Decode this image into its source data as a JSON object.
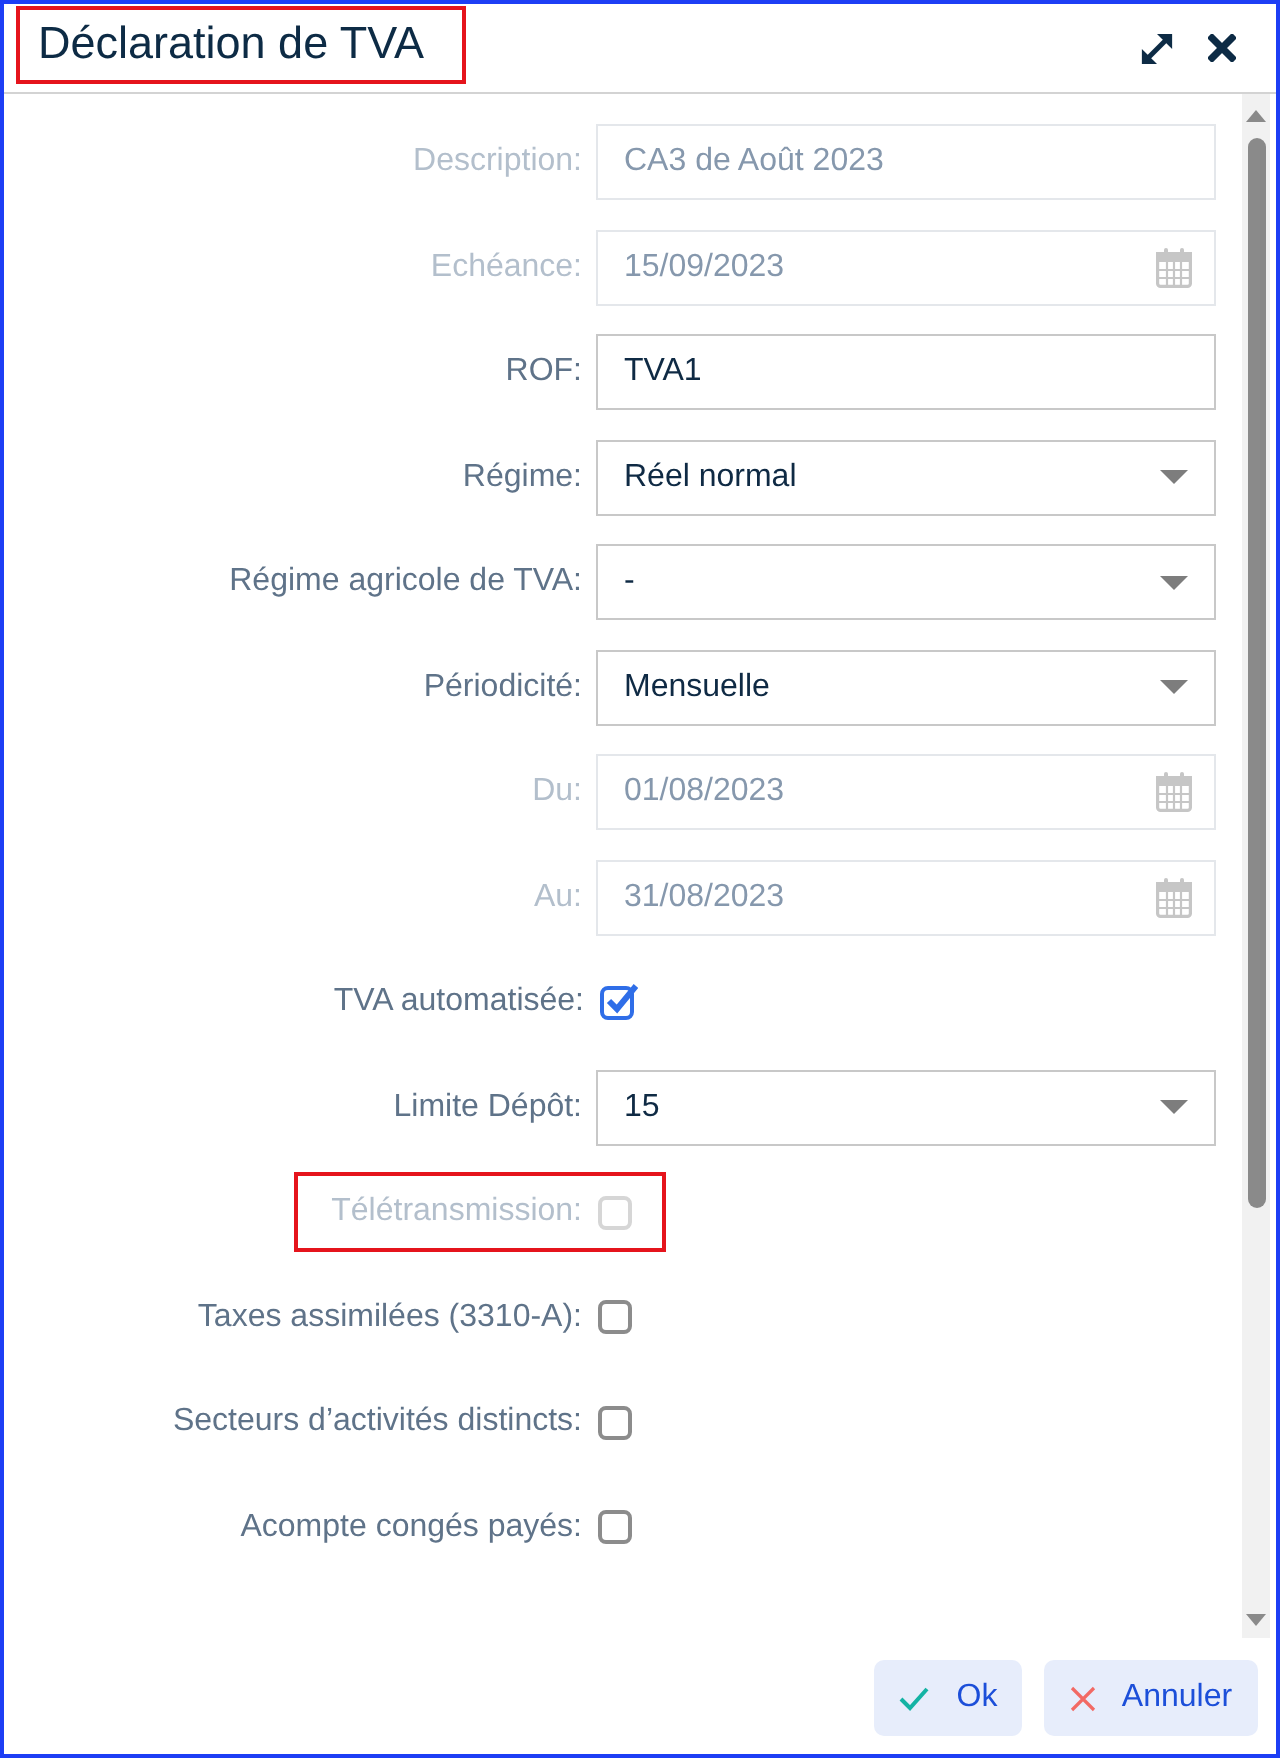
{
  "window": {
    "title": "Déclaration de TVA",
    "highlighted": true
  },
  "fields": [
    {
      "kind": "text",
      "label": "Description:",
      "value": "CA3 de Août 2023",
      "disabled": true,
      "highlighted": false
    },
    {
      "kind": "date",
      "label": "Echéance:",
      "value": "15/09/2023",
      "disabled": true,
      "highlighted": false
    },
    {
      "kind": "text",
      "label": "ROF:",
      "value": "TVA1",
      "disabled": false,
      "highlighted": false
    },
    {
      "kind": "select",
      "label": "Régime:",
      "value": "Réel normal",
      "disabled": false,
      "highlighted": false
    },
    {
      "kind": "select",
      "label": "Régime agricole de TVA:",
      "value": "-",
      "disabled": false,
      "highlighted": false
    },
    {
      "kind": "select",
      "label": "Périodicité:",
      "value": "Mensuelle",
      "disabled": false,
      "highlighted": false
    },
    {
      "kind": "date",
      "label": "Du:",
      "value": "01/08/2023",
      "disabled": true,
      "highlighted": false
    },
    {
      "kind": "date",
      "label": "Au:",
      "value": "31/08/2023",
      "disabled": true,
      "highlighted": false
    },
    {
      "kind": "checkbox",
      "label": "TVA automatisée:",
      "checked": true,
      "disabled": false,
      "highlighted": false
    },
    {
      "kind": "select",
      "label": "Limite Dépôt:",
      "value": "15",
      "disabled": false,
      "highlighted": false
    },
    {
      "kind": "checkbox",
      "label": "Télétransmission:",
      "checked": false,
      "disabled": true,
      "highlighted": true
    },
    {
      "kind": "checkbox",
      "label": "Taxes assimilées (3310-A):",
      "checked": false,
      "disabled": false,
      "highlighted": false
    },
    {
      "kind": "checkbox",
      "label": "Secteurs d’activités distincts:",
      "checked": false,
      "disabled": false,
      "highlighted": false
    },
    {
      "kind": "checkbox",
      "label": "Acompte congés payés:",
      "checked": false,
      "disabled": false,
      "highlighted": false
    }
  ],
  "buttons": [
    {
      "kind": "ok",
      "label": "Ok"
    },
    {
      "kind": "cancel",
      "label": "Annuler"
    }
  ]
}
